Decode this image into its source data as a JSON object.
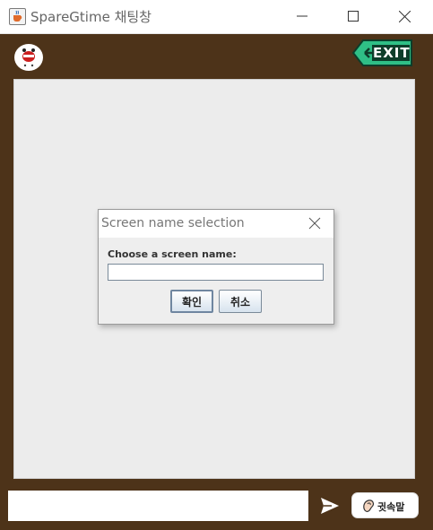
{
  "window": {
    "title": "SpareGtime 채팅창"
  },
  "header": {
    "exit_label": "EXIT"
  },
  "dialog": {
    "title": "Screen name selection",
    "prompt": "Choose a screen name:",
    "input_value": "",
    "ok_label": "확인",
    "cancel_label": "취소"
  },
  "footer": {
    "message_value": "",
    "whisper_label": "귓속말"
  },
  "colors": {
    "frame_background": "#4d3319",
    "exit_sign": "#2fbf86",
    "chat_background": "#ececec"
  },
  "icons": {
    "app": "java-cup-icon",
    "avatar": "emoji-face-icon",
    "exit": "exit-sign-icon",
    "send": "paper-plane-icon",
    "whisper": "ear-icon"
  }
}
